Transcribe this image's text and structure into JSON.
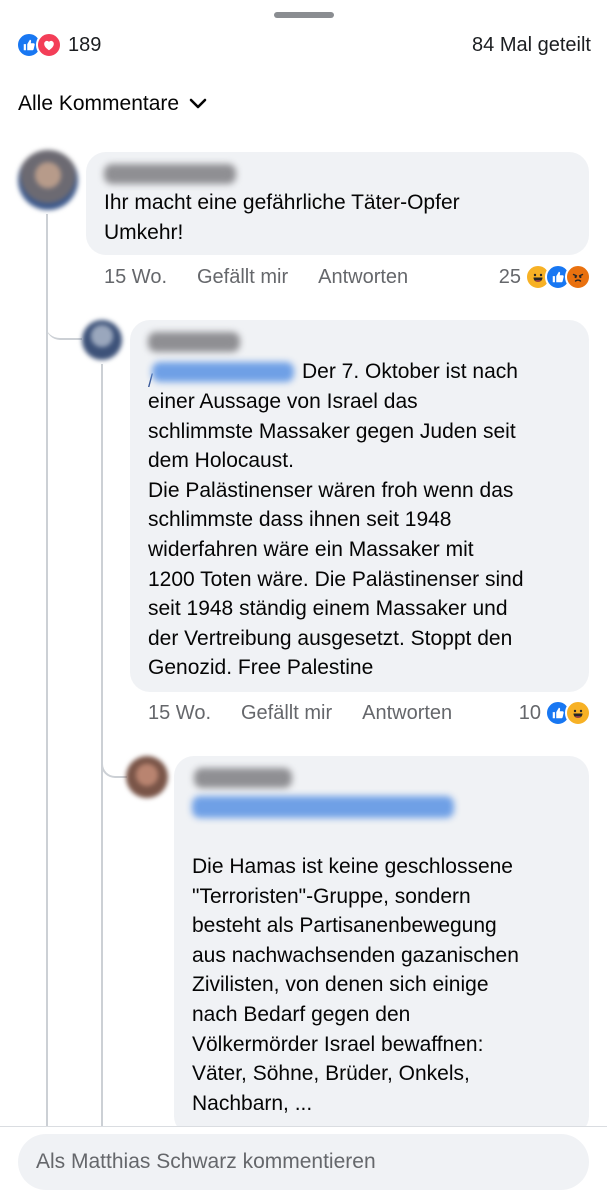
{
  "reactions": {
    "count": "189",
    "shares": "84 Mal geteilt",
    "icons": [
      "like-icon",
      "love-icon"
    ]
  },
  "filter": {
    "label": "Alle Kommentare",
    "icon": "chevron-down-icon"
  },
  "comments": [
    {
      "text": "Ihr macht eine gefährliche Täter-Opfer\nUmkehr!",
      "time": "15 Wo.",
      "like_label": "Gefällt mir",
      "reply_label": "Antworten",
      "reaction_count": "25",
      "reaction_icons": [
        "haha-icon",
        "like-icon",
        "angry-icon"
      ]
    },
    {
      "mention_prefix": "/",
      "text_first_line": "Der 7. Oktober ist nach",
      "text": "einer Aussage von Israel das\nschlimmste Massaker gegen Juden seit\ndem Holocaust.\nDie Palästinenser wären froh wenn das\nschlimmste dass ihnen seit 1948\nwiderfahren wäre ein Massaker mit\n1200 Toten wäre. Die Palästinenser sind\nseit 1948 ständig einem Massaker und\nder Vertreibung ausgesetzt. Stoppt den\nGenozid. Free Palestine",
      "time": "15 Wo.",
      "like_label": "Gefällt mir",
      "reply_label": "Antworten",
      "reaction_count": "10",
      "reaction_icons": [
        "like-icon",
        "haha-icon"
      ]
    },
    {
      "text": "Die Hamas ist keine geschlossene\n\"Terroristen\"-Gruppe, sondern\nbesteht als Partisanenbewegung\naus nachwachsenden gazanischen\nZivilisten, von denen sich einige\nnach Bedarf gegen den\nVölkermörder Israel bewaffnen:\nVäter, Söhne, Brüder, Onkels,\nNachbarn, ..."
    }
  ],
  "composer": {
    "placeholder": "Als Matthias Schwarz kommentieren"
  },
  "colors": {
    "like": "#1877f2",
    "love": "#f33e58",
    "haha": "#f7b125",
    "angry": "#e9710f",
    "bubble": "#f0f2f5"
  }
}
